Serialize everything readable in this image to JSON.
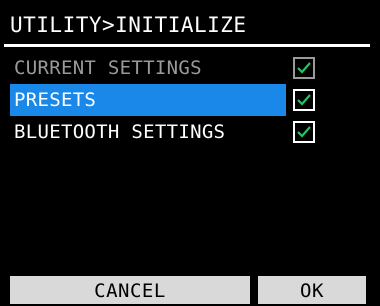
{
  "header": {
    "title": "UTILITY>INITIALIZE"
  },
  "items": [
    {
      "label": "CURRENT SETTINGS",
      "checked": true,
      "state": "dimmed"
    },
    {
      "label": "PRESETS",
      "checked": true,
      "state": "selected"
    },
    {
      "label": "BLUETOOTH SETTINGS",
      "checked": true,
      "state": "normal"
    }
  ],
  "footer": {
    "cancel_label": "CANCEL",
    "ok_label": "OK"
  },
  "colors": {
    "background": "#000000",
    "selection": "#1a88e8",
    "check_mark": "#22c55e",
    "softkey": "#d9d9d9"
  }
}
